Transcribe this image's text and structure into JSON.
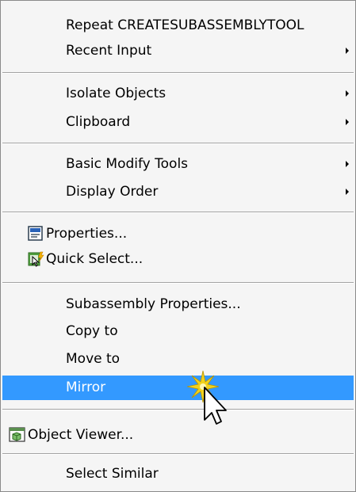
{
  "menu": {
    "items": [
      {
        "label": "Repeat CREATESUBASSEMBLYTOOL"
      },
      {
        "label": "Recent Input"
      },
      {
        "label": "Isolate Objects"
      },
      {
        "label": "Clipboard"
      },
      {
        "label": "Basic Modify Tools"
      },
      {
        "label": "Display Order"
      },
      {
        "label": "Properties..."
      },
      {
        "label": "Quick Select..."
      },
      {
        "label": "Subassembly Properties..."
      },
      {
        "label": "Copy to"
      },
      {
        "label": "Move to"
      },
      {
        "label": "Mirror"
      },
      {
        "label": "Object Viewer..."
      },
      {
        "label": "Select Similar"
      }
    ],
    "highlighted_item": "Mirror",
    "highlight_color": "#3399ff",
    "submenu_items": [
      "Recent Input",
      "Isolate Objects",
      "Clipboard",
      "Basic Modify Tools",
      "Display Order"
    ],
    "icons": {
      "properties": "properties-icon",
      "quick_select": "quick-select-icon",
      "object_viewer": "object-viewer-icon",
      "cursor": "mouse-pointer-icon"
    }
  }
}
